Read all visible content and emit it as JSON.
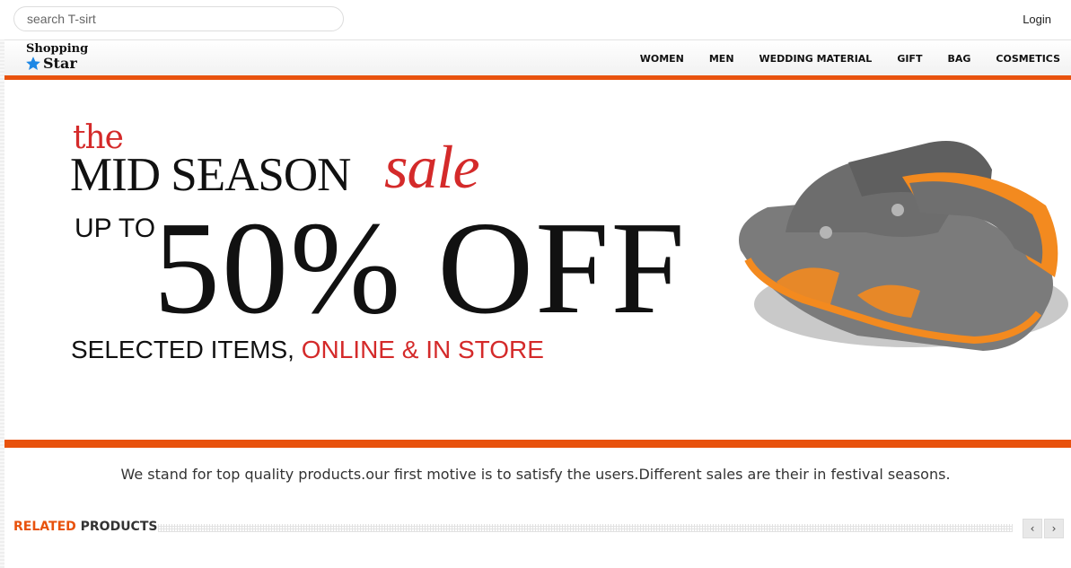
{
  "search": {
    "placeholder": "search T-sirt"
  },
  "header": {
    "login_label": "Login"
  },
  "logo": {
    "line1": "Shopping",
    "line2": "Star",
    "icon": "star-icon",
    "star_color": "#1e88e5"
  },
  "nav": {
    "items": [
      "WOMEN",
      "MEN",
      "WEDDING MATERIAL",
      "GIFT",
      "BAG",
      "COSMETICS"
    ]
  },
  "banner": {
    "the": "the",
    "mid_season": "MID SEASON",
    "sale": "sale",
    "up_to": "UP TO",
    "discount": "50% OFF",
    "selected": "SELECTED ITEMS,",
    "online": "ONLINE & IN STORE",
    "product_image": "sandal"
  },
  "tagline": "We stand for top quality products.our first motive is to satisfy the users.Different sales are their in festival seasons.",
  "related": {
    "highlight": "RELATED",
    "rest": "PRODUCTS",
    "prev_icon": "chevron-left-icon",
    "next_icon": "chevron-right-icon"
  },
  "colors": {
    "accent": "#e8520d",
    "sale_red": "#d42a2a"
  }
}
